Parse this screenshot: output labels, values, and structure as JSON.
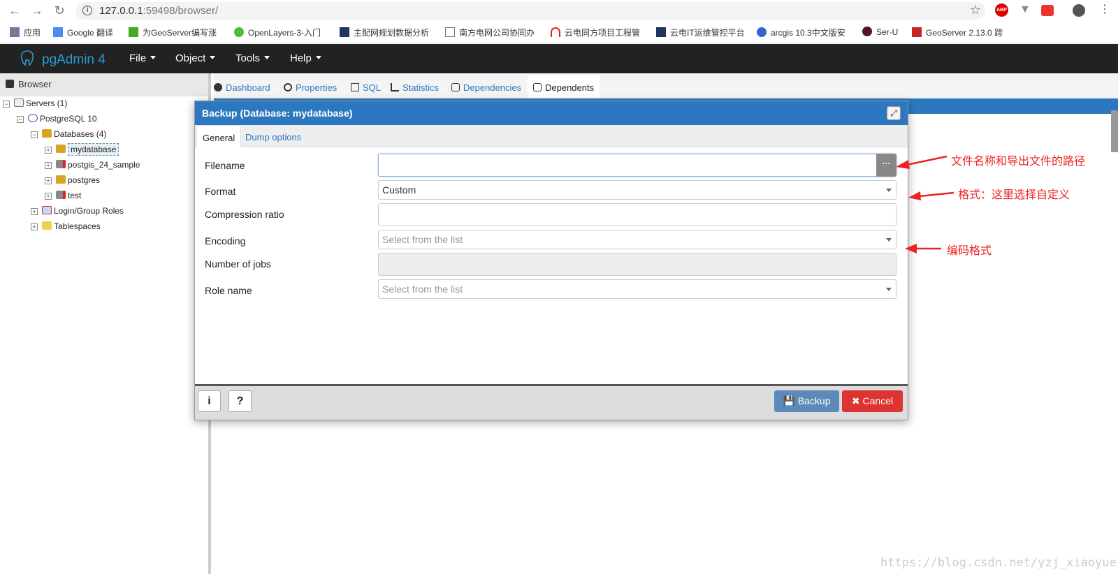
{
  "browser": {
    "url_host": "127.0.0.1",
    "url_port": ":59498",
    "url_path": "/browser/",
    "bookmarks": [
      {
        "label": "应用"
      },
      {
        "label": "Google 翻译"
      },
      {
        "label": "为GeoServer编写涨"
      },
      {
        "label": "OpenLayers-3-入门"
      },
      {
        "label": "主配网规划数据分析"
      },
      {
        "label": "南方电网公司协同办"
      },
      {
        "label": "云电同方项目工程管"
      },
      {
        "label": "云电IT运维管控平台"
      },
      {
        "label": "arcgis 10.3中文版安"
      },
      {
        "label": "Ser-U"
      },
      {
        "label": "GeoServer 2.13.0 跨"
      }
    ],
    "ext_abp": "ABP"
  },
  "app": {
    "brand": "pgAdmin 4",
    "menus": [
      "File",
      "Object",
      "Tools",
      "Help"
    ]
  },
  "left_panel": {
    "title": "Browser",
    "tree": {
      "servers": "Servers (1)",
      "server": "PostgreSQL 10",
      "databases": "Databases (4)",
      "db1": "mydatabase",
      "db2": "postgis_24_sample",
      "db3": "postgres",
      "db4": "test",
      "roles": "Login/Group Roles",
      "tablespaces": "Tablespaces"
    }
  },
  "main_tabs": [
    "Dashboard",
    "Properties",
    "SQL",
    "Statistics",
    "Dependencies",
    "Dependents"
  ],
  "dialog": {
    "title": "Backup (Database: mydatabase)",
    "tabs": [
      "General",
      "Dump options"
    ],
    "fields": {
      "filename_label": "Filename",
      "filename_value": "",
      "format_label": "Format",
      "format_value": "Custom",
      "compression_label": "Compression ratio",
      "compression_value": "",
      "encoding_label": "Encoding",
      "encoding_placeholder": "Select from the list",
      "jobs_label": "Number of jobs",
      "role_label": "Role name",
      "role_placeholder": "Select from the list"
    },
    "footer": {
      "info": "i",
      "help": "?",
      "backup": "Backup",
      "cancel": "Cancel"
    }
  },
  "annotations": {
    "a1": "文件名称和导出文件的路径",
    "a2": "格式：这里选择自定义",
    "a3": "编码格式"
  },
  "watermark": "https://blog.csdn.net/yzj_xiaoyue"
}
